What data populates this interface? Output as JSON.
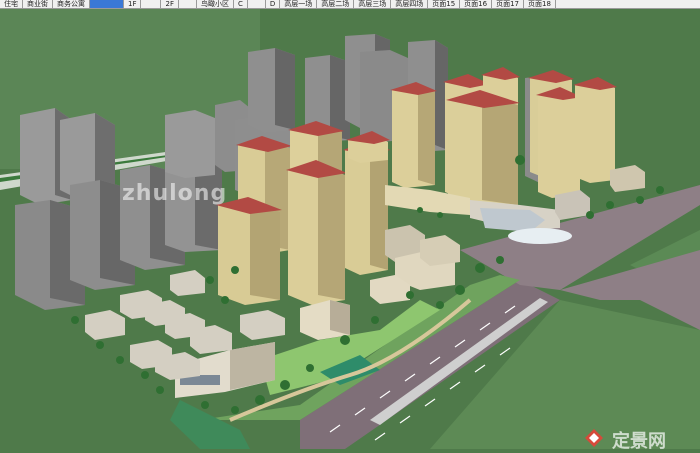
{
  "tabs": [
    {
      "label": "住宅"
    },
    {
      "label": "商业街"
    },
    {
      "label": "商务公寓"
    },
    {
      "label": "",
      "active": true
    },
    {
      "label": "1F"
    },
    {
      "label": ""
    },
    {
      "label": "2F"
    },
    {
      "label": ""
    },
    {
      "label": "鸟瞰小区"
    },
    {
      "label": "C"
    },
    {
      "label": ""
    },
    {
      "label": "D"
    },
    {
      "label": "高层一场"
    },
    {
      "label": "高层二场"
    },
    {
      "label": "高层三场"
    },
    {
      "label": "高层四场"
    },
    {
      "label": "页面15"
    },
    {
      "label": "页面16"
    },
    {
      "label": "页面17"
    },
    {
      "label": "页面18"
    }
  ],
  "watermark_top": "zhulong",
  "watermark_bottom": "定景网",
  "colors": {
    "ground": "#4f7a4a",
    "road": "#8e7f86",
    "tower": "#8a8a8a",
    "apartment": "#dccf9c",
    "roof": "#b24a44",
    "tab_active": "#3a78d6"
  }
}
